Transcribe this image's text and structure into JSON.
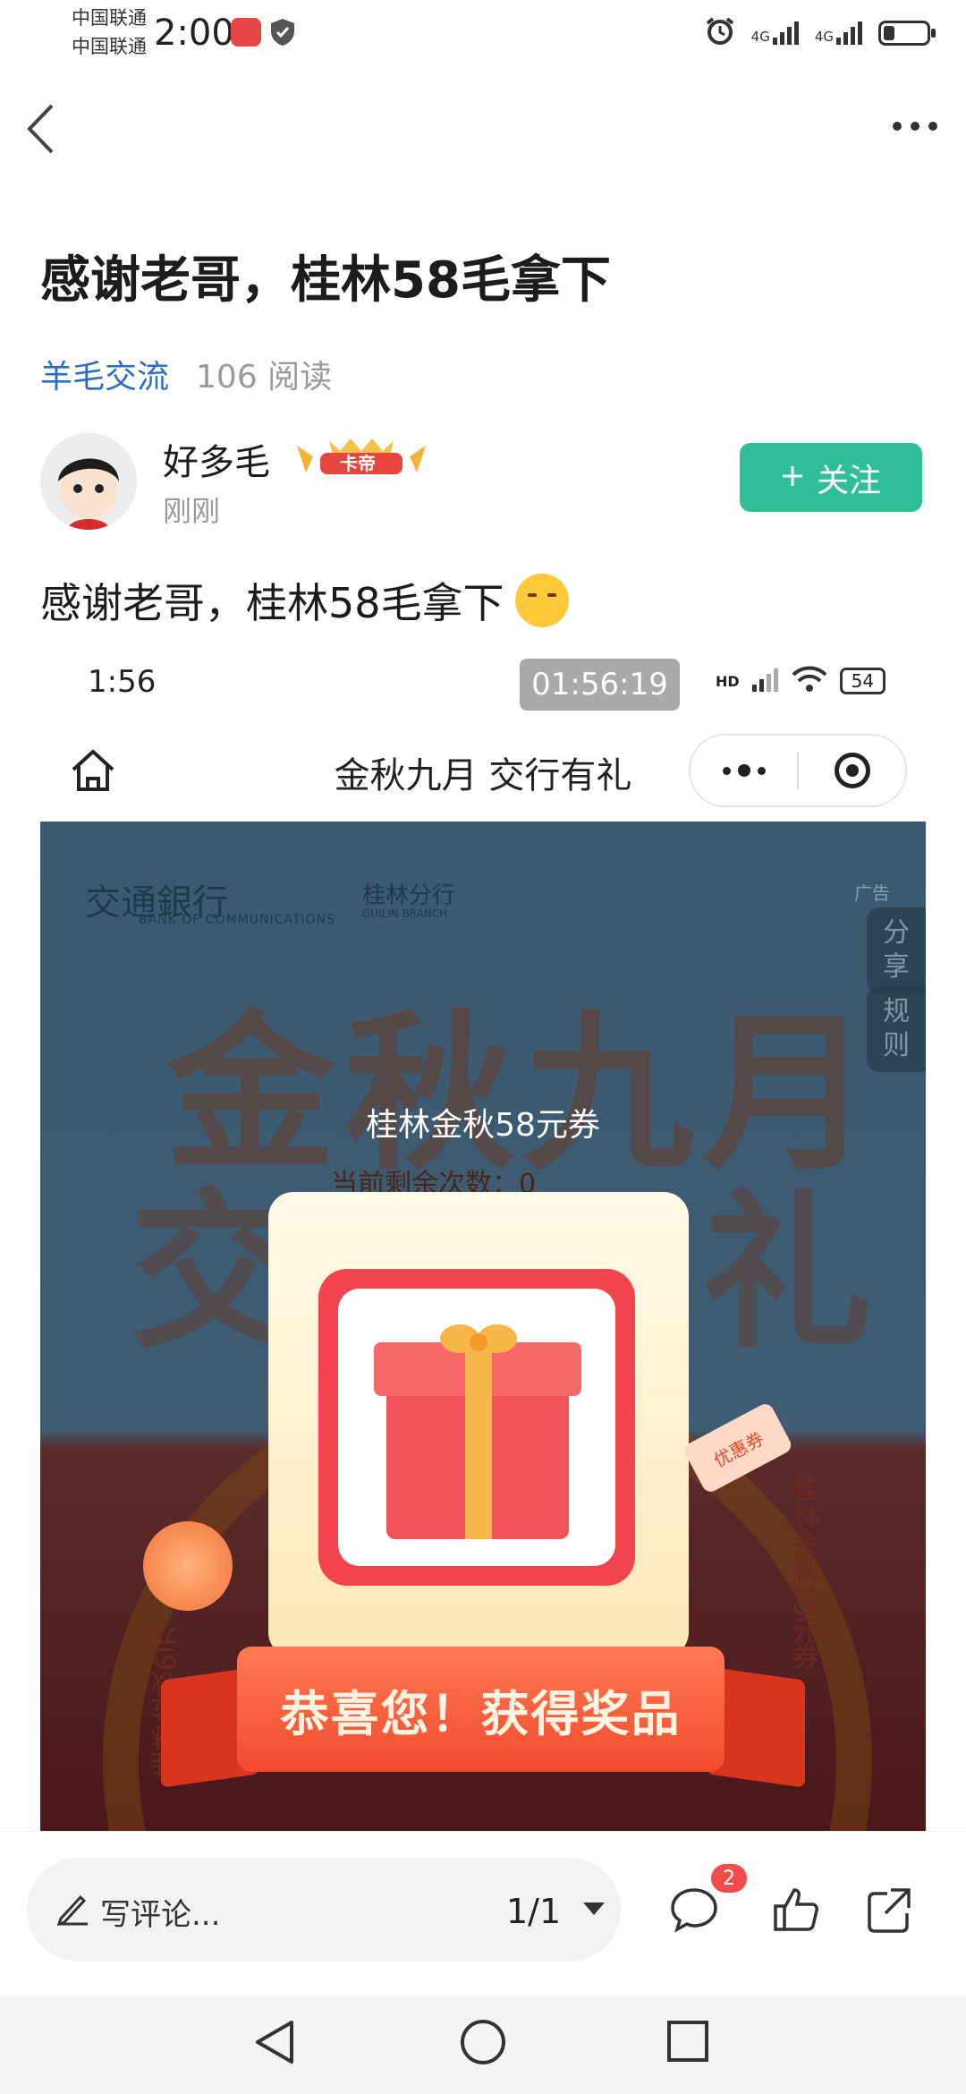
{
  "status_bar": {
    "carrier_1": "中国联通",
    "carrier_2": "中国联通",
    "time": "2:00",
    "network_1": "4G",
    "network_2": "4G",
    "battery_level": 0.25
  },
  "post": {
    "title": "感谢老哥，桂林58毛拿下",
    "category": "羊毛交流",
    "reads": "106 阅读",
    "author": {
      "name": "好多毛",
      "badge": "卡帝",
      "time": "刚刚"
    },
    "follow_label": "关注",
    "body_text": "感谢老哥，桂林58毛拿下"
  },
  "embedded_screenshot": {
    "status_time": "1:56",
    "recording_time": "01:56:19",
    "battery": "54",
    "hd_label": "HD",
    "mini_title": "金秋九月 交行有礼",
    "banner": {
      "bank_name": "交通銀行",
      "bank_name_en": "BANK OF COMMUNICATIONS",
      "branch": "桂林分行",
      "branch_en": "GUILIN BRANCH",
      "ad_label": "广告",
      "headline_1": "金秋九月",
      "headline_2_left": "交",
      "headline_2_right": "礼",
      "share_tab": "分享",
      "rules_tab": "规则",
      "side_prize_left": "桂林金秋6元",
      "side_prize_right": "桂林金秋10元券"
    },
    "prize_name": "桂林金秋58元券",
    "remaining": "当前剩余次数：0",
    "coupon_tag": "优惠券",
    "congrats": "恭喜您！获得奖品"
  },
  "bottom_bar": {
    "comment_placeholder": "写评论...",
    "page_indicator": "1/1",
    "comment_count": "2"
  }
}
